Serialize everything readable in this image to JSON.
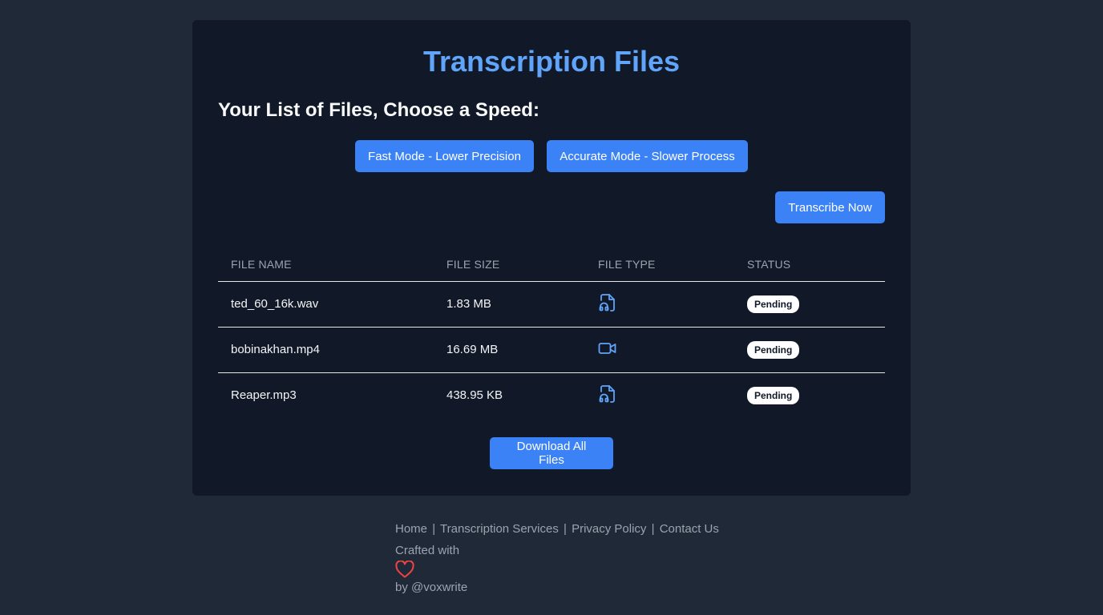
{
  "header": {
    "title": "Transcription Files",
    "subtitle": "Your List of Files, Choose a Speed:"
  },
  "modes": {
    "fast_label": "Fast Mode - Lower Precision",
    "accurate_label": "Accurate Mode - Slower Process"
  },
  "actions": {
    "transcribe_label": "Transcribe Now",
    "download_label": "Download All Files"
  },
  "table": {
    "columns": [
      "FILE NAME",
      "FILE SIZE",
      "FILE TYPE",
      "STATUS"
    ],
    "rows": [
      {
        "name": "ted_60_16k.wav",
        "size": "1.83 MB",
        "type_icon": "audio-file-icon",
        "status": "Pending"
      },
      {
        "name": "bobinakhan.mp4",
        "size": "16.69 MB",
        "type_icon": "video-camera-icon",
        "status": "Pending"
      },
      {
        "name": "Reaper.mp3",
        "size": "438.95 KB",
        "type_icon": "audio-file-icon",
        "status": "Pending"
      }
    ]
  },
  "footer": {
    "links": [
      "Home",
      "Transcription Services",
      "Privacy Policy",
      "Contact Us"
    ],
    "separator": "|",
    "crafted": "Crafted with",
    "heart_icon": "heart-icon",
    "by": "by @voxwrite"
  },
  "colors": {
    "page_bg": "#1f2937",
    "card_bg": "#111827",
    "accent": "#3b82f6",
    "title": "#60a5fa",
    "icon": "#60a5fa",
    "heart": "#ef4444"
  }
}
